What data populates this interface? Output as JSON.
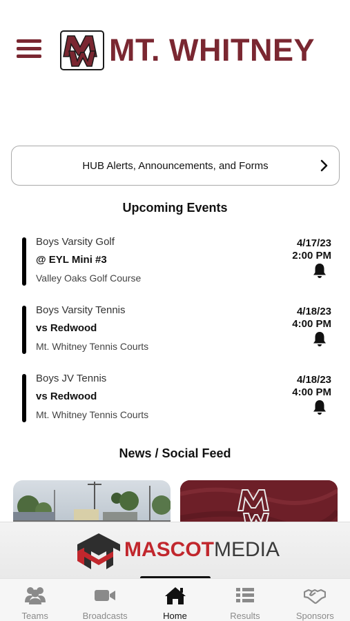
{
  "header": {
    "school_name": "MT. WHITNEY",
    "logo_monogram": "MW",
    "brand_color": "#7a2731"
  },
  "hub_button": {
    "label": "HUB Alerts, Announcements, and Forms",
    "icon": "chevron-right-icon"
  },
  "upcoming": {
    "title": "Upcoming Events",
    "events": [
      {
        "sport": "Boys Varsity Golf",
        "opponent": "@ EYL Mini #3",
        "location": "Valley Oaks Golf Course",
        "date": "4/17/23",
        "time": "2:00 PM",
        "icon": "bell-icon"
      },
      {
        "sport": "Boys Varsity Tennis",
        "opponent": "vs Redwood",
        "location": "Mt. Whitney Tennis Courts",
        "date": "4/18/23",
        "time": "4:00 PM",
        "icon": "bell-icon"
      },
      {
        "sport": "Boys JV Tennis",
        "opponent": "vs Redwood",
        "location": "Mt. Whitney Tennis Courts",
        "date": "4/18/23",
        "time": "4:00 PM",
        "icon": "bell-icon"
      }
    ]
  },
  "news": {
    "title": "News / Social Feed"
  },
  "sponsor_banner": {
    "word_part1": "MASCOT",
    "word_part2": "MEDIA",
    "colors": {
      "red": "#c1272d",
      "dark": "#3a3a3a"
    }
  },
  "tabbar": {
    "tabs": [
      {
        "label": "Teams",
        "icon": "teams-icon",
        "active": false
      },
      {
        "label": "Broadcasts",
        "icon": "video-camera-icon",
        "active": false
      },
      {
        "label": "Home",
        "icon": "home-icon",
        "active": true
      },
      {
        "label": "Results",
        "icon": "list-icon",
        "active": false
      },
      {
        "label": "Sponsors",
        "icon": "handshake-icon",
        "active": false
      }
    ]
  }
}
